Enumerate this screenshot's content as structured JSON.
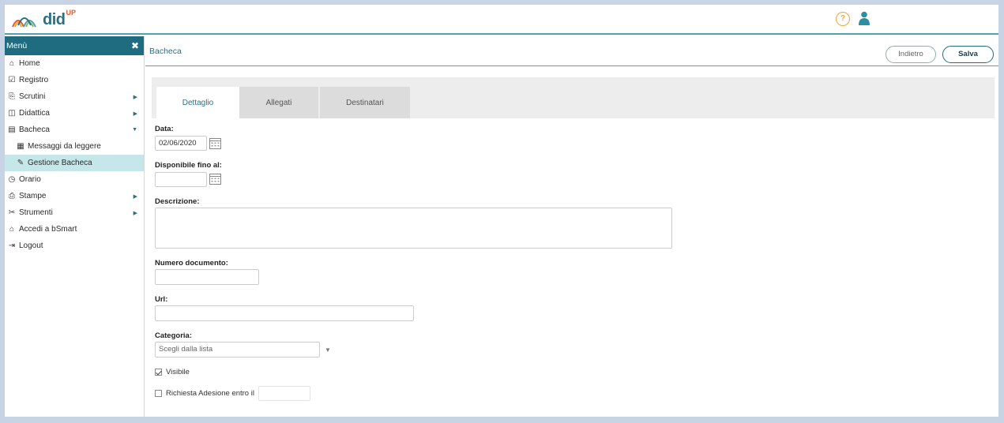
{
  "app": {
    "logo_text": "did",
    "logo_sup": "UP",
    "help_symbol": "?",
    "icons": [
      "rainbow-logo-icon",
      "help-circle-icon",
      "user-icon"
    ]
  },
  "colors": {
    "primary": "#1f6b80",
    "accent_line": "#4fa3b0",
    "active_menu": "#c5e7ea",
    "help": "#f0a735",
    "logo_orange": "#e85b27"
  },
  "sidebar": {
    "title": "Menù",
    "close_symbol": "✖",
    "items": [
      {
        "label": "Home",
        "icon": "⌂"
      },
      {
        "label": "Registro",
        "icon": "☑"
      },
      {
        "label": "Scrutini",
        "icon": "⎘",
        "arrow": "▶"
      },
      {
        "label": "Didattica",
        "icon": "◫",
        "arrow": "▶"
      },
      {
        "label": "Bacheca",
        "icon": "▤",
        "arrow": "▼"
      },
      {
        "label": "Messaggi da leggere",
        "icon": "▦"
      },
      {
        "label": "Gestione Bacheca",
        "icon": "✎"
      },
      {
        "label": "Orario",
        "icon": "◷"
      },
      {
        "label": "Stampe",
        "icon": "⎙",
        "arrow": "▶"
      },
      {
        "label": "Strumenti",
        "icon": "✂",
        "arrow": "▶"
      },
      {
        "label": "Accedi a bSmart",
        "icon": "⌂"
      },
      {
        "label": "Logout",
        "icon": "⇥"
      }
    ]
  },
  "header": {
    "title": "Bacheca",
    "back_label": "Indietro",
    "save_label": "Salva"
  },
  "tabs": [
    {
      "label": "Dettaglio"
    },
    {
      "label": "Allegati"
    },
    {
      "label": "Destinatari"
    }
  ],
  "form": {
    "data_label": "Data:",
    "data_value": "02/06/2020",
    "disponibile_label": "Disponibile fino al:",
    "disponibile_value": "",
    "descrizione_label": "Descrizione:",
    "descrizione_value": "",
    "numero_label": "Numero documento:",
    "numero_value": "",
    "url_label": "Url:",
    "url_value": "",
    "categoria_label": "Categoria:",
    "categoria_placeholder": "Scegli dalla lista",
    "select_arrow": "▼",
    "visibile_label": "Visibile",
    "visibile_checked": true,
    "adesione_label": "Richiesta Adesione entro il",
    "adesione_checked": false,
    "adesione_value": ""
  }
}
